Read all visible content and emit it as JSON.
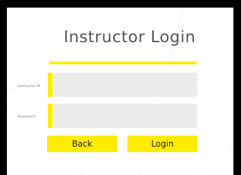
{
  "page": {
    "title": "Instructor Login"
  },
  "form": {
    "instructor_label": "Instructor #",
    "instructor_value": "",
    "password_label": "Password",
    "password_value": ""
  },
  "buttons": {
    "back_label": "Back",
    "login_label": "Login"
  },
  "colors": {
    "accent": "#ffec00",
    "input_bg": "#ebebeb",
    "title_text": "#545454",
    "outer_bg": "#000000",
    "panel_bg": "#ffffff"
  }
}
